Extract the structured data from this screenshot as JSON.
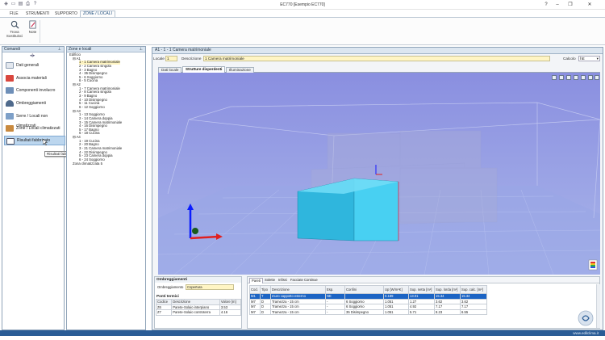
{
  "window": {
    "title": "EC770 [Esempio EC770]"
  },
  "menu": [
    "FILE",
    "STRUMENTI",
    "SUPPORTO",
    "ZONE / LOCALI"
  ],
  "ribbon": {
    "buttons": [
      "Trova Sostituisci",
      "Note"
    ]
  },
  "comandi": {
    "title": "Comandi",
    "items": [
      "Dati generali",
      "Associa materiali",
      "Componenti involucro",
      "Ombreggiamenti",
      "Serre / Locali non climatizzati",
      "Zone / Locali climatizzati",
      "Risultati fabbricato"
    ],
    "tooltip": "Risultati fabbricato"
  },
  "tree": {
    "title": "Zone e locali",
    "root": "Edificio",
    "groups": [
      {
        "name": "A1",
        "items": [
          "1 - 1 Camera matrimoniale",
          "2 - 2 Camera singola",
          "3 - 3 Bagno",
          "4 - 35 Disimpegno",
          "5 - 6 Soggiorno",
          "6 - 5 Cucina"
        ]
      },
      {
        "name": "A2",
        "items": [
          "1 - 7 Camera matrimoniale",
          "2 - 8 Camera singola",
          "3 - 9 Bagno",
          "4 - 10 Disimpegno",
          "5 - 11 Cucina",
          "6 - 12 Soggiorno"
        ]
      },
      {
        "name": "A3",
        "items": [
          "1 - 13 Soggiorno",
          "2 - 14 Camera doppia",
          "3 - 15 Camera matrimoniale",
          "4 - 16 Disimpegno",
          "5 - 17 Bagno",
          "6 - 18 Cucina"
        ]
      },
      {
        "name": "A4",
        "items": [
          "1 - 19 Cucina",
          "2 - 20 Bagno",
          "3 - 21 Camera matrimoniale",
          "4 - 22 Disimpegno",
          "5 - 23 Camera doppia",
          "6 - 24 Soggiorno"
        ]
      }
    ],
    "footer": "Zona climatizzata 5"
  },
  "main": {
    "title": "A1 - 1 - 1 Camera matrimoniale",
    "locale_label": "Locale",
    "locale_value": "1",
    "descr_label": "Descrizione",
    "descr_value": "1 Camera matrimoniale",
    "calcolo_label": "Calcolo",
    "calcolo_value": "hE",
    "tabs": [
      "Dati locale",
      "Strutture disperdenti",
      "Illuminazione"
    ]
  },
  "ombre": {
    "title": "Ombreggiamenti",
    "label": "Ombreggiamento",
    "value": "Copertura",
    "pt_title": "Ponti termici",
    "headers": [
      "Codice",
      "Descrizione",
      "Valore [m]"
    ],
    "rows": [
      [
        "Z6",
        "Parete-Solaio interpiano",
        "3.53"
      ],
      [
        "Z7",
        "Parete-Solaio controterra",
        "4.16"
      ]
    ]
  },
  "pareti": {
    "tabs": [
      "Pareti",
      "Solette",
      "Infissi",
      "Facciate Continue"
    ],
    "headers": [
      "Cod.",
      "Tipo",
      "Descrizione",
      "Esp.",
      "Confini",
      "Up [W/m²K]",
      "Sup. netta [m²]",
      "Sup. lorda [m²]",
      "Sup. calc. [m²]"
    ],
    "rows": [
      [
        "M1",
        "T",
        "muro cappotto esterno",
        "NE",
        "",
        "0.189",
        "13.01",
        "15.34",
        "15.34"
      ],
      [
        "M7",
        "D",
        "Tramezza - 15 cm",
        "-",
        "6 Soggiorno",
        "1.051",
        "1.27",
        "3.62",
        "3.62"
      ],
      [
        "M7",
        "D",
        "Tramezza - 15 cm",
        "-",
        "6 Soggiorno",
        "1.051",
        "4.92",
        "7.17",
        "7.17"
      ],
      [
        "M7",
        "D",
        "Tramezza - 15 cm",
        "-",
        "35 Disimpegno",
        "1.051",
        "5.71",
        "8.23",
        "6.55"
      ]
    ]
  },
  "footer": {
    "url": "www.edilclima.it"
  },
  "colors": {
    "accent": "#2a5c96",
    "room": "#3fc4e6",
    "viewport": "#8d92e0"
  }
}
